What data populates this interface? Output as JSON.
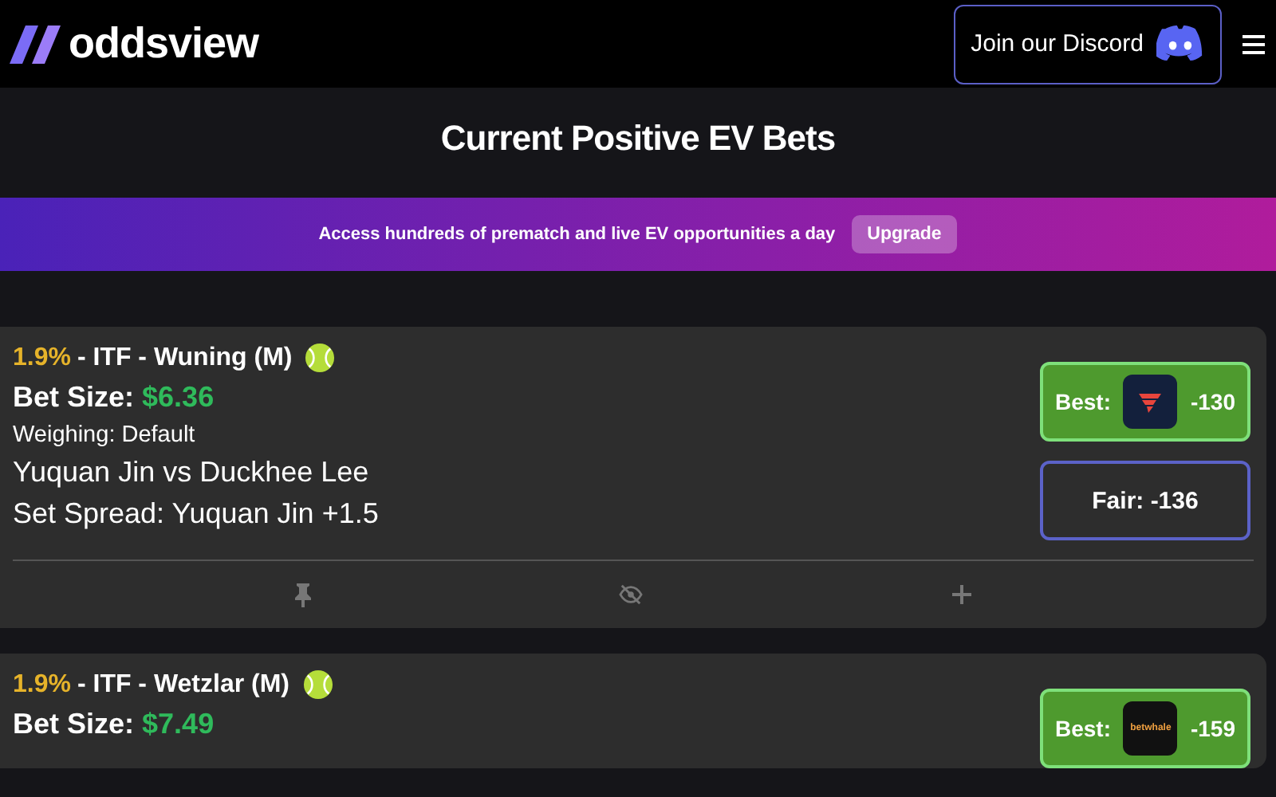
{
  "header": {
    "brand": "oddsview",
    "discord_button": "Join our Discord"
  },
  "title": "Current Positive EV Bets",
  "banner": {
    "text": "Access hundreds of prematch and live EV opportunities a day",
    "button": "Upgrade"
  },
  "bets": [
    {
      "ev": "1.9%",
      "event": "- ITF - Wuning (M)",
      "bet_size_label": "Bet Size:",
      "bet_size": "$6.36",
      "weighing": "Weighing: Default",
      "matchup": "Yuquan Jin vs Duckhee Lee",
      "market": "Set Spread: Yuquan Jin +1.5",
      "best": {
        "label": "Best:",
        "book": {
          "kind": "icon"
        },
        "odds": "-130"
      },
      "fair": "Fair: -136"
    },
    {
      "ev": "1.9%",
      "event": "- ITF - Wetzlar (M)",
      "bet_size_label": "Bet Size:",
      "bet_size": "$7.49",
      "best": {
        "label": "Best:",
        "book": {
          "kind": "wordmark",
          "text": "betwhale"
        },
        "odds": "-159"
      }
    }
  ]
}
